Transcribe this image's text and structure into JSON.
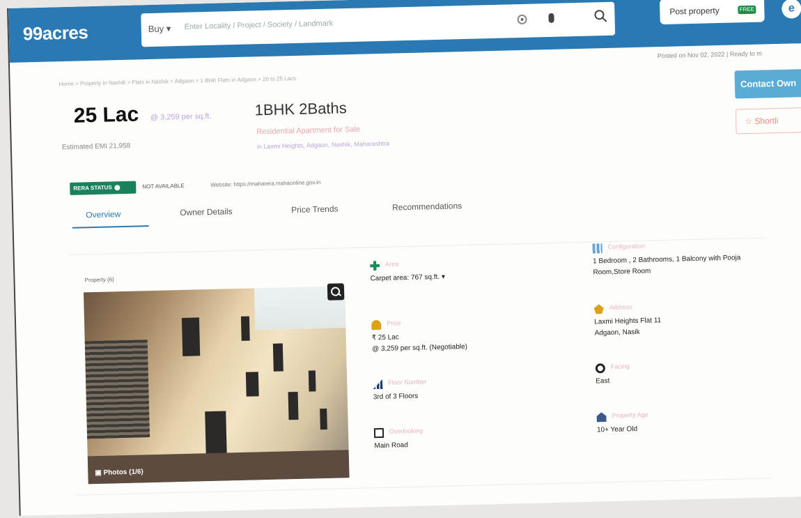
{
  "header": {
    "logo": "99acres",
    "search": {
      "buy_label": "Buy ▾",
      "placeholder": "Enter Locality / Project / Society / Landmark"
    },
    "post_property_label": "Post property",
    "free_badge": "FREE",
    "user_initial": "e"
  },
  "posted_on": "Posted on Nov 02, 2022  |  Ready to m",
  "breadcrumb": "Home > Property in Nashik > Flats in Nashik > Adgaon > 1 BHK Flats in Adgaon > 20 to 25 Lacs",
  "listing": {
    "price": "25 Lac",
    "per_sqft": "@ 3,259 per sq.ft.",
    "emi": "Estimated EMI 21,958",
    "config": "1BHK 2Baths",
    "type": "Residential Apartment for Sale",
    "locality": "in Laxmi Heights, Adgaon, Nashik, Maharashtra"
  },
  "actions": {
    "contact": "Contact Own",
    "shortlist": "☆ Shortli"
  },
  "rera": {
    "badge": "RERA STATUS",
    "status": "NOT AVAILABLE",
    "website": "Website: https://maharera.mahaonline.gov.in"
  },
  "tabs": [
    "Overview",
    "Owner Details",
    "Price Trends",
    "Recommendations"
  ],
  "gallery": {
    "count_label": "Property (6)",
    "photos_label": "▣ Photos (1/6)"
  },
  "details_left": [
    {
      "icon": "area-icon",
      "label": "Area",
      "value": "Carpet area: 767  sq.ft. ▾"
    },
    {
      "icon": "price-icon",
      "label": "Price",
      "value": "₹ 25 Lac\n@ 3,259 per sq.ft. (Negotiable)"
    },
    {
      "icon": "floor-icon",
      "label": "Floor Number",
      "value": "3rd of 3 Floors"
    },
    {
      "icon": "facing-road-icon",
      "label": "Overlooking",
      "value": "Main Road"
    }
  ],
  "details_right": [
    {
      "icon": "config-icon",
      "label": "Configuration",
      "value": "1 Bedroom , 2 Bathrooms, 1 Balcony with Pooja\nRoom,Store Room"
    },
    {
      "icon": "address-icon",
      "label": "Address",
      "value": "Laxmi Heights Flat 11\nAdgaon, Nasik"
    },
    {
      "icon": "facing-icon",
      "label": "Facing",
      "value": "East"
    },
    {
      "icon": "age-icon",
      "label": "Property Age",
      "value": "10+ Year Old"
    }
  ],
  "colors": {
    "brand": "#2b79b3",
    "rera_green": "#19815c",
    "contact_blue": "#5aabd6"
  }
}
